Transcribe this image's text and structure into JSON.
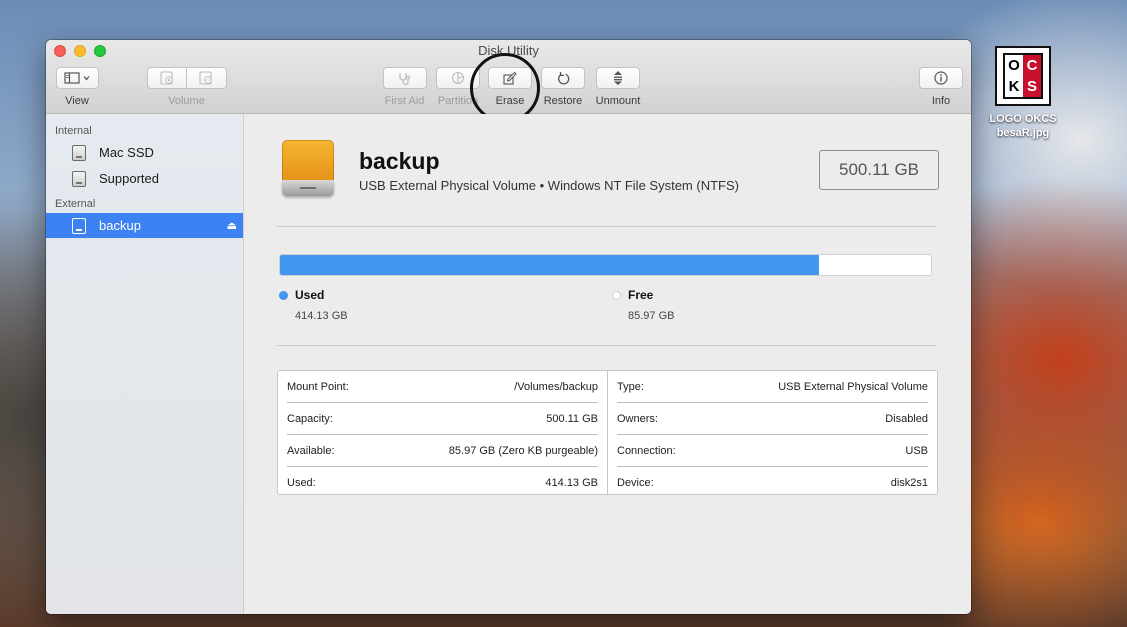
{
  "window": {
    "title": "Disk Utility"
  },
  "toolbar": {
    "view_label": "View",
    "volume_label": "Volume",
    "first_aid_label": "First Aid",
    "partition_label": "Partition",
    "erase_label": "Erase",
    "restore_label": "Restore",
    "unmount_label": "Unmount",
    "info_label": "Info"
  },
  "sidebar": {
    "internal_header": "Internal",
    "external_header": "External",
    "internal_items": [
      {
        "label": "Mac SSD"
      },
      {
        "label": "Supported"
      }
    ],
    "external_items": [
      {
        "label": "backup",
        "selected": true
      }
    ]
  },
  "volume": {
    "name": "backup",
    "description": "USB External Physical Volume • Windows NT File System (NTFS)",
    "capacity": "500.11 GB",
    "used_fraction": 0.828
  },
  "usage": {
    "used_label": "Used",
    "used_value": "414.13 GB",
    "used_color": "#4196f0",
    "free_label": "Free",
    "free_value": "85.97 GB",
    "free_color": "#ffffff"
  },
  "info": {
    "left": [
      {
        "label": "Mount Point:",
        "value": "/Volumes/backup"
      },
      {
        "label": "Capacity:",
        "value": "500.11 GB"
      },
      {
        "label": "Available:",
        "value": "85.97 GB (Zero KB purgeable)"
      },
      {
        "label": "Used:",
        "value": "414.13 GB"
      }
    ],
    "right": [
      {
        "label": "Type:",
        "value": "USB External Physical Volume"
      },
      {
        "label": "Owners:",
        "value": "Disabled"
      },
      {
        "label": "Connection:",
        "value": "USB"
      },
      {
        "label": "Device:",
        "value": "disk2s1"
      }
    ]
  },
  "desktop": {
    "icon_label_line1": "LOGO OKCS",
    "icon_label_line2": "besaR.jpg",
    "logo_letters": [
      "O",
      "C",
      "K",
      "S"
    ]
  }
}
